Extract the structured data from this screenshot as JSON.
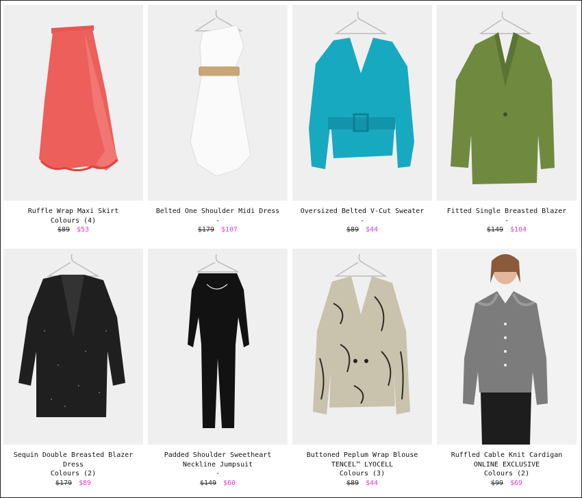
{
  "products": [
    {
      "name": "Ruffle Wrap Maxi Skirt",
      "line2": "",
      "extra": "Colours (4)",
      "old_price": "$89",
      "new_price": "$53",
      "image": "coral-ruffle-skirt"
    },
    {
      "name": "Belted One Shoulder Midi Dress",
      "line2": "",
      "extra": "-",
      "old_price": "$179",
      "new_price": "$107",
      "image": "white-lace-dress"
    },
    {
      "name": "Oversized Belted V-Cut Sweater",
      "line2": "",
      "extra": "-",
      "old_price": "$89",
      "new_price": "$44",
      "image": "teal-sweater"
    },
    {
      "name": "Fitted Single Breasted Blazer",
      "line2": "",
      "extra": "-",
      "old_price": "$149",
      "new_price": "$104",
      "image": "olive-blazer"
    },
    {
      "name": "Sequin Double Breasted Blazer",
      "line2": "Dress",
      "extra": "Colours (2)",
      "old_price": "$179",
      "new_price": "$89",
      "image": "black-sequin-blazer-dress"
    },
    {
      "name": "Padded Shoulder Sweetheart",
      "line2": "Neckline Jumpsuit",
      "extra": "-",
      "old_price": "$149",
      "new_price": "$60",
      "image": "black-jumpsuit"
    },
    {
      "name": "Buttoned Peplum Wrap Blouse",
      "line2": "TENCEL™ LYOCELL",
      "extra": "Colours (3)",
      "old_price": "$89",
      "new_price": "$44",
      "image": "zebra-print-blouse"
    },
    {
      "name": "Ruffled Cable Knit Cardigan",
      "line2": "ONLINE EXCLUSIVE",
      "extra": "Colours (2)",
      "old_price": "$99",
      "new_price": "$69",
      "image": "grey-knit-cardigan"
    }
  ],
  "colors": {
    "sale": "#e23bd0",
    "image_bg": "#ececec"
  }
}
